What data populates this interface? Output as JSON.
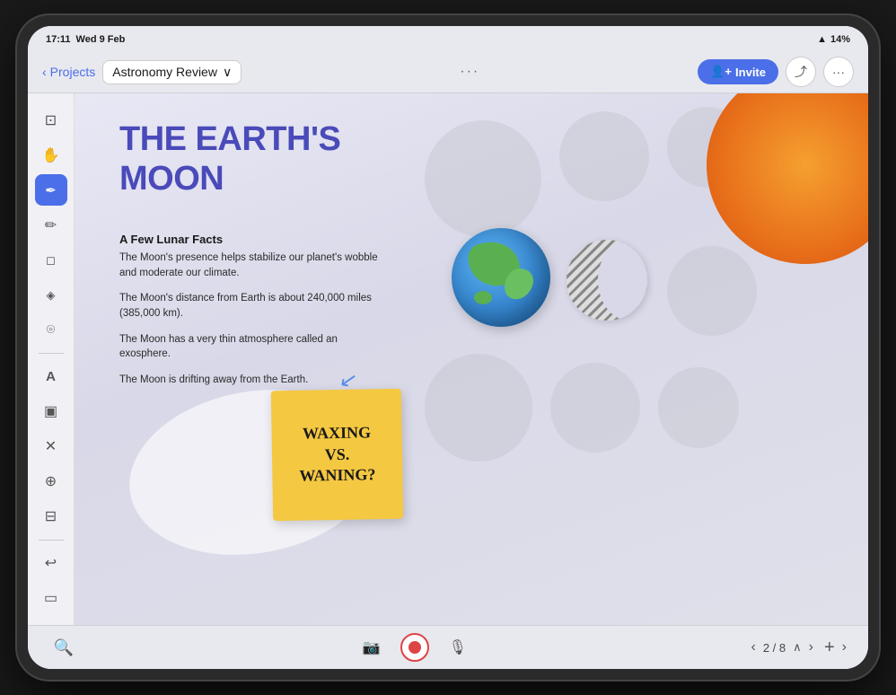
{
  "statusBar": {
    "time": "17:11",
    "date": "Wed 9 Feb",
    "wifi": "WiFi",
    "battery": "14%"
  },
  "navBar": {
    "backLabel": "Projects",
    "docName": "Astronomy Review",
    "ellipsis": "···",
    "inviteLabel": "Invite",
    "shareLabel": "Share",
    "moreLabel": "···"
  },
  "toolbar": {
    "tools": [
      {
        "name": "select-tool",
        "icon": "⊡",
        "label": "Select"
      },
      {
        "name": "hand-tool",
        "icon": "✋",
        "label": "Pan"
      },
      {
        "name": "pen-tool",
        "icon": "✏️",
        "label": "Pen",
        "active": true
      },
      {
        "name": "pencil-tool",
        "icon": "✏",
        "label": "Pencil"
      },
      {
        "name": "eraser-tool",
        "icon": "◻",
        "label": "Eraser"
      },
      {
        "name": "fill-tool",
        "icon": "◈",
        "label": "Fill"
      },
      {
        "name": "lasso-tool",
        "icon": "⌾",
        "label": "Lasso"
      },
      {
        "name": "text-tool",
        "icon": "A",
        "label": "Text"
      },
      {
        "name": "shape-tool",
        "icon": "▣",
        "label": "Shape"
      },
      {
        "name": "close-tool",
        "icon": "✕",
        "label": "Delete"
      },
      {
        "name": "timer-tool",
        "icon": "⊕",
        "label": "Timer"
      },
      {
        "name": "frame-tool",
        "icon": "⊟",
        "label": "Frame"
      },
      {
        "name": "undo-btn",
        "icon": "↩",
        "label": "Undo"
      },
      {
        "name": "screen-tool",
        "icon": "▭",
        "label": "Screen"
      }
    ]
  },
  "slide": {
    "title_line1": "THE EARTH'S",
    "title_line2": "MOON",
    "subtitle": "A Few Lunar Facts",
    "facts": [
      "The Moon's presence helps stabilize our planet's wobble and moderate our climate.",
      "The Moon's distance from Earth is about 240,000 miles (385,000 km).",
      "The Moon has a very thin atmosphere called an exosphere.",
      "The Moon is drifting away from the Earth."
    ],
    "stickyNote": {
      "line1": "WAXING",
      "line2": "VS.",
      "line3": "WANING?"
    }
  },
  "bottomBar": {
    "zoomIcon": "⊕",
    "cameraIcon": "📷",
    "micIcon": "🎤",
    "pageInfo": "2 / 8",
    "prevLabel": "‹",
    "nextLabel": "›",
    "upLabel": "∧",
    "addLabel": "+"
  },
  "colors": {
    "accent": "#4a6fe8",
    "titleColor": "#4a4aba",
    "orange": "#e8701a",
    "sticky": "#f5c842"
  }
}
